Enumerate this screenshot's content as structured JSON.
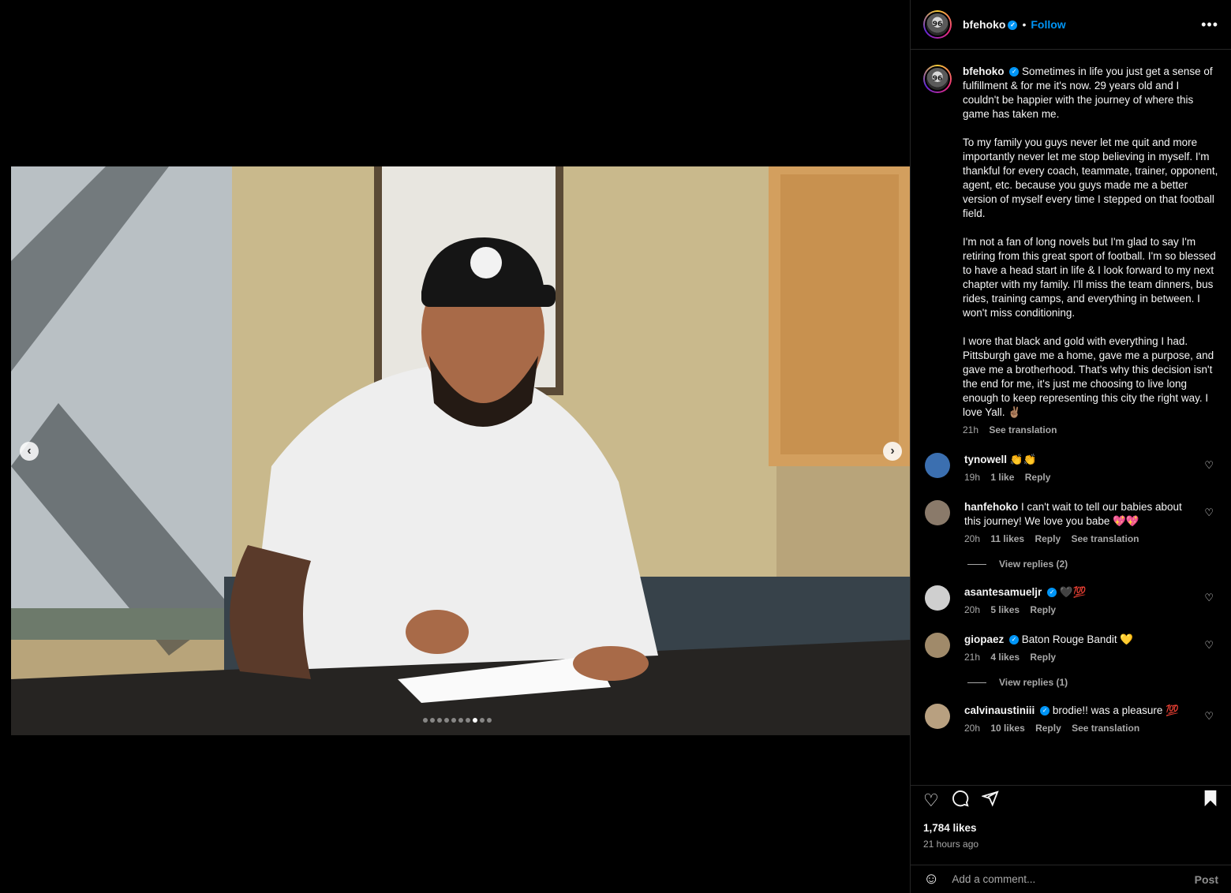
{
  "media": {
    "slide_count": 10,
    "active_slide": 8
  },
  "header": {
    "username": "bfehoko",
    "separator": "•",
    "follow_label": "Follow",
    "more_label": "•••",
    "avatar_text": "96"
  },
  "caption": {
    "username": "bfehoko",
    "paragraphs": [
      "Sometimes in life you just get a sense of fulfillment & for me it's now. 29 years old and I couldn't be happier with the journey of where this game has taken me.",
      "To my family you guys never let me quit and more importantly never let me stop believing in myself. I'm thankful for every coach, teammate, trainer, opponent, agent, etc. because you guys made me a better version of myself every time I stepped on that football field.",
      "I'm not a fan of long novels but I'm glad to say I'm retiring from this great sport of football. I'm so blessed to have a head start in life & I look forward to my next chapter with my family. I'll miss the team dinners, bus rides, training camps, and everything in between. I won't miss conditioning.",
      "I wore that black and gold with everything I had. Pittsburgh gave me a home, gave me a purpose, and gave me a brotherhood. That's why this decision isn't the end for me, it's just me choosing to live long enough to keep representing this city the right way. I love Yall. ✌🏽"
    ],
    "time": "21h",
    "see_translation": "See translation"
  },
  "comments": [
    {
      "username": "tynowell",
      "verified": false,
      "text": "👏👏",
      "time": "19h",
      "likes": "1 like",
      "reply": "Reply",
      "translation": "",
      "avatar_color": "#3b6fb0"
    },
    {
      "username": "hanfehoko",
      "verified": false,
      "text": "I can't wait to tell our babies about this journey! We love you babe 💖💖",
      "time": "20h",
      "likes": "11 likes",
      "reply": "Reply",
      "translation": "See translation",
      "avatar_color": "#8a7a6a",
      "view_replies": "View replies (2)"
    },
    {
      "username": "asantesamueljr",
      "verified": true,
      "text": "🖤💯",
      "time": "20h",
      "likes": "5 likes",
      "reply": "Reply",
      "translation": "",
      "avatar_color": "#cfcfcf"
    },
    {
      "username": "giopaez",
      "verified": true,
      "text": "Baton Rouge Bandit 💛",
      "time": "21h",
      "likes": "4 likes",
      "reply": "Reply",
      "translation": "",
      "avatar_color": "#a08a6a",
      "view_replies": "View replies (1)"
    },
    {
      "username": "calvinaustiniii",
      "verified": true,
      "text": "brodie!! was a pleasure 💯",
      "time": "20h",
      "likes": "10 likes",
      "reply": "Reply",
      "translation": "See translation",
      "avatar_color": "#b8a080"
    }
  ],
  "actions": {
    "likes": "1,784 likes",
    "time_ago": "21 hours ago"
  },
  "add_comment": {
    "placeholder": "Add a comment...",
    "post_label": "Post"
  },
  "colors": {
    "accent": "#0095f6",
    "background": "#000000",
    "muted_text": "#a8a8a8"
  }
}
